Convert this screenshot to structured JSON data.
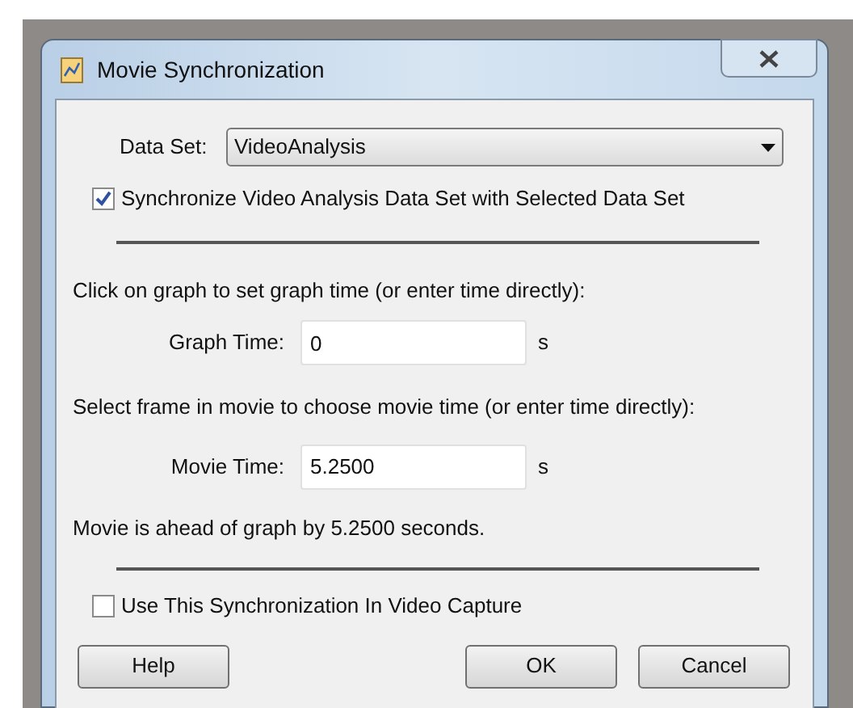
{
  "window": {
    "title": "Movie Synchronization"
  },
  "data_set": {
    "label": "Data Set:",
    "value": "VideoAnalysis"
  },
  "sync_checkbox": {
    "label": "Synchronize Video Analysis Data Set with Selected Data Set",
    "checked": true
  },
  "graph_instruction": "Click on graph to set graph time (or enter time directly):",
  "graph_time": {
    "label": "Graph Time:",
    "value": "0",
    "unit": "s"
  },
  "movie_instruction": "Select frame in movie to choose movie time (or enter time directly):",
  "movie_time": {
    "label": "Movie Time:",
    "value": "5.2500",
    "unit": "s"
  },
  "status": "Movie is ahead of graph by 5.2500 seconds.",
  "capture_checkbox": {
    "label": "Use This Synchronization In Video Capture",
    "checked": false
  },
  "buttons": [
    {
      "label": "Help"
    },
    {
      "label": "OK"
    },
    {
      "label": "Cancel"
    }
  ]
}
